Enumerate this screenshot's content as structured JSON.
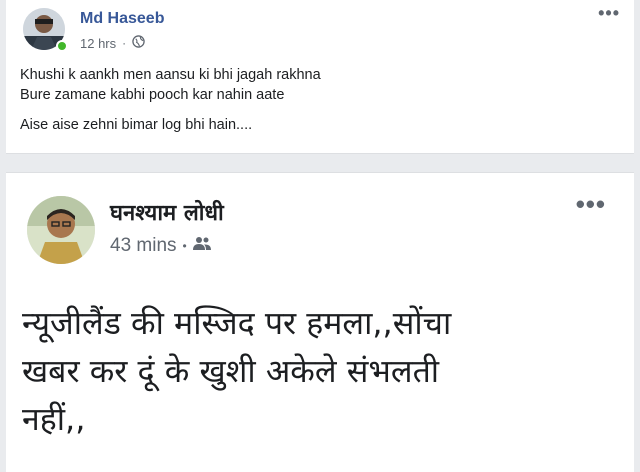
{
  "posts": [
    {
      "author": "Md Haseeb",
      "time": "12 hrs",
      "privacy_icon": "globe-icon",
      "lines": [
        "Khushi k aankh men aansu ki bhi jagah rakhna",
        "Bure zamane kabhi pooch kar nahin aate",
        "Aise aise zehni bimar log bhi hain...."
      ]
    },
    {
      "author": "घनश्याम लोधी",
      "time": "43 mins",
      "privacy_icon": "friends-icon",
      "lines": [
        "न्यूजीलैंड की मस्जिद पर हमला,,सोंचा",
        "खबर कर दूं के खुशी अकेले संभलती",
        "नहीं,,"
      ]
    }
  ],
  "more_label": "•••",
  "colors": {
    "link": "#385898",
    "online": "#42b72a",
    "meta": "#606770"
  }
}
